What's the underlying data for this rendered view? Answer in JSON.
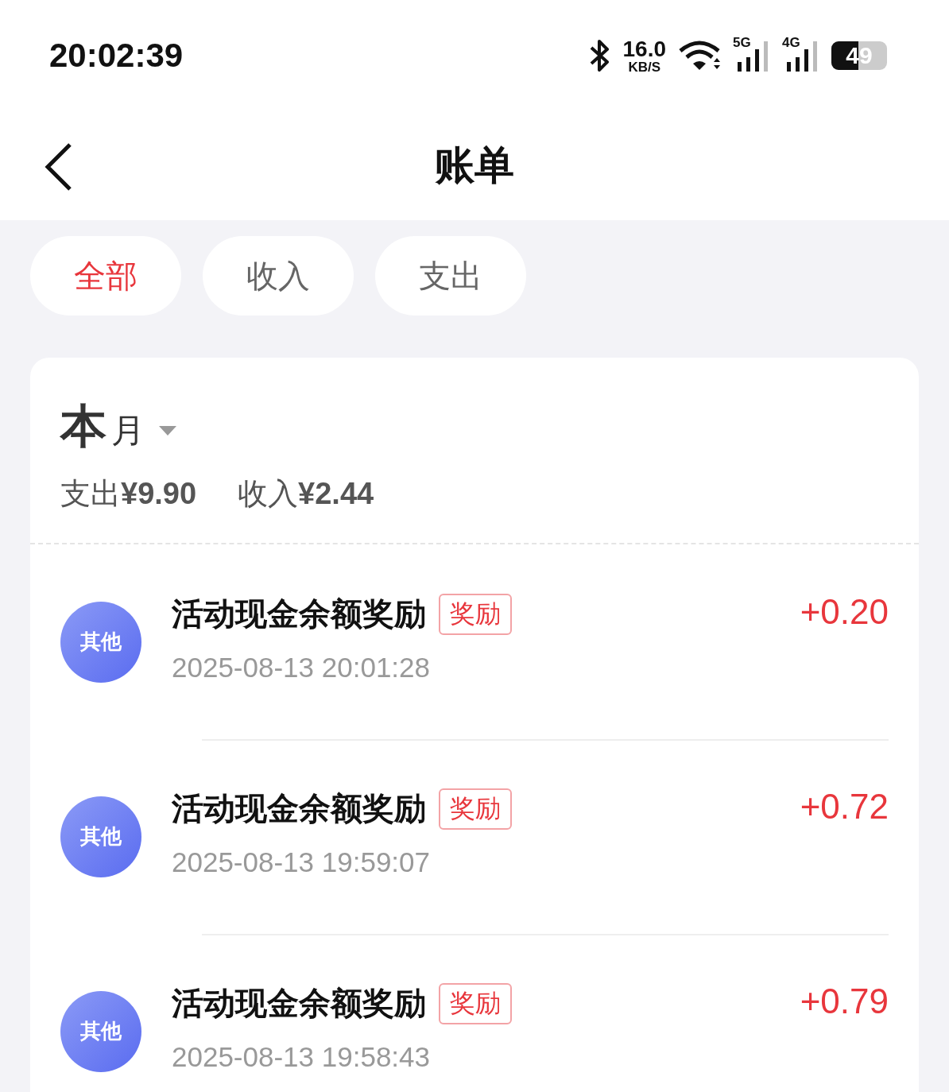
{
  "status_bar": {
    "time": "20:02:39",
    "net_speed": "16.0",
    "net_speed_unit": "KB/S",
    "signals": [
      {
        "label": "5G"
      },
      {
        "label": "4G"
      }
    ],
    "battery": "49"
  },
  "header": {
    "title": "账单"
  },
  "filters": [
    {
      "label": "全部",
      "selected": true
    },
    {
      "label": "收入",
      "selected": false
    },
    {
      "label": "支出",
      "selected": false
    }
  ],
  "summary": {
    "period": "本",
    "period_unit": "月",
    "expense": "支出**¥9.90**",
    "income": "收入**¥2.44**"
  },
  "transactions": [
    {
      "category": "其他",
      "title": "活动现金余额奖励",
      "tag": "奖励",
      "time": "2025-08-13 20:01:28",
      "amount": "+0.20"
    },
    {
      "category": "其他",
      "title": "活动现金余额奖励",
      "tag": "奖励",
      "time": "2025-08-13 19:59:07",
      "amount": "+0.72"
    },
    {
      "category": "其他",
      "title": "活动现金余额奖励",
      "tag": "奖励",
      "time": "2025-08-13 19:58:43",
      "amount": "+0.79"
    }
  ]
}
